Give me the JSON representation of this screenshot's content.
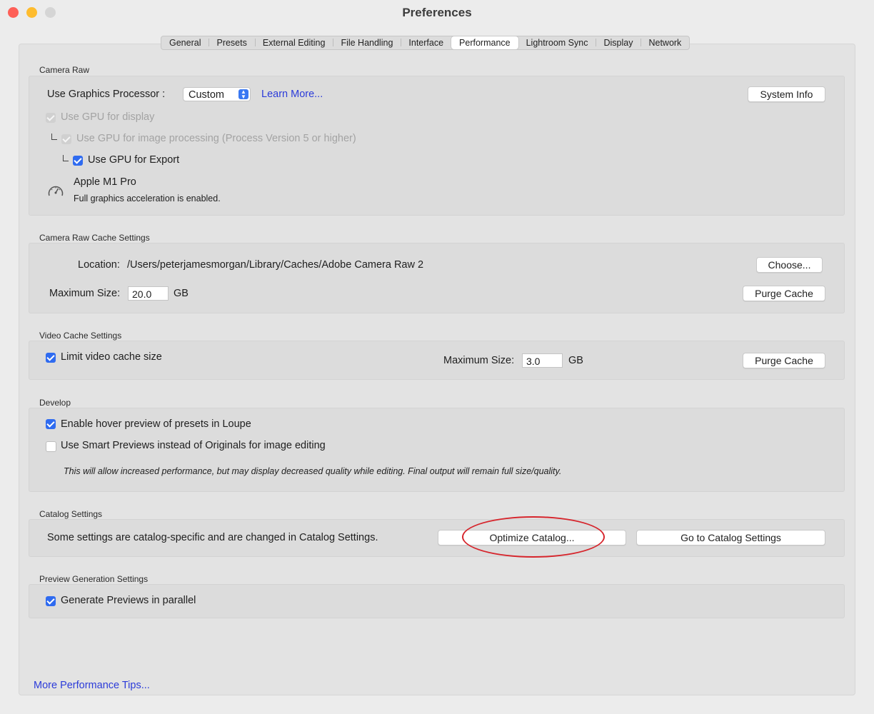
{
  "window": {
    "title": "Preferences"
  },
  "tabs": [
    "General",
    "Presets",
    "External Editing",
    "File Handling",
    "Interface",
    "Performance",
    "Lightroom Sync",
    "Display",
    "Network"
  ],
  "active_tab": "Performance",
  "camera_raw": {
    "section_label": "Camera Raw",
    "gpu_label": "Use Graphics Processor :",
    "gpu_value": "Custom",
    "learn_more": "Learn More...",
    "system_info": "System Info",
    "gpu_display": "Use GPU for display",
    "gpu_processing": "Use GPU for image processing (Process Version 5 or higher)",
    "gpu_export": "Use GPU for Export",
    "device_name": "Apple M1 Pro",
    "device_status": "Full graphics acceleration is enabled."
  },
  "cache": {
    "section_label": "Camera Raw Cache Settings",
    "location_label": "Location:",
    "location_value": "/Users/peterjamesmorgan/Library/Caches/Adobe Camera Raw 2",
    "choose": "Choose...",
    "max_size_label": "Maximum Size:",
    "max_size_value": "20.0",
    "unit": "GB",
    "purge": "Purge Cache"
  },
  "video_cache": {
    "section_label": "Video Cache Settings",
    "limit_label": "Limit video cache size",
    "max_size_label": "Maximum Size:",
    "max_size_value": "3.0",
    "unit": "GB",
    "purge": "Purge Cache"
  },
  "develop": {
    "section_label": "Develop",
    "hover_preview": "Enable hover preview of presets in Loupe",
    "smart_previews": "Use Smart Previews instead of Originals for image editing",
    "note": "This will allow increased performance, but may display decreased quality while editing. Final output will remain full size/quality."
  },
  "catalog": {
    "section_label": "Catalog Settings",
    "text": "Some settings are catalog-specific and are changed in Catalog Settings.",
    "optimize": "Optimize Catalog...",
    "goto": "Go to Catalog Settings"
  },
  "preview": {
    "section_label": "Preview Generation Settings",
    "parallel": "Generate Previews in parallel"
  },
  "footer": {
    "tips_link": "More Performance Tips..."
  },
  "colors": {
    "accent": "#2f6bf0",
    "link": "#2b3bd9",
    "highlight": "#d6252c"
  }
}
